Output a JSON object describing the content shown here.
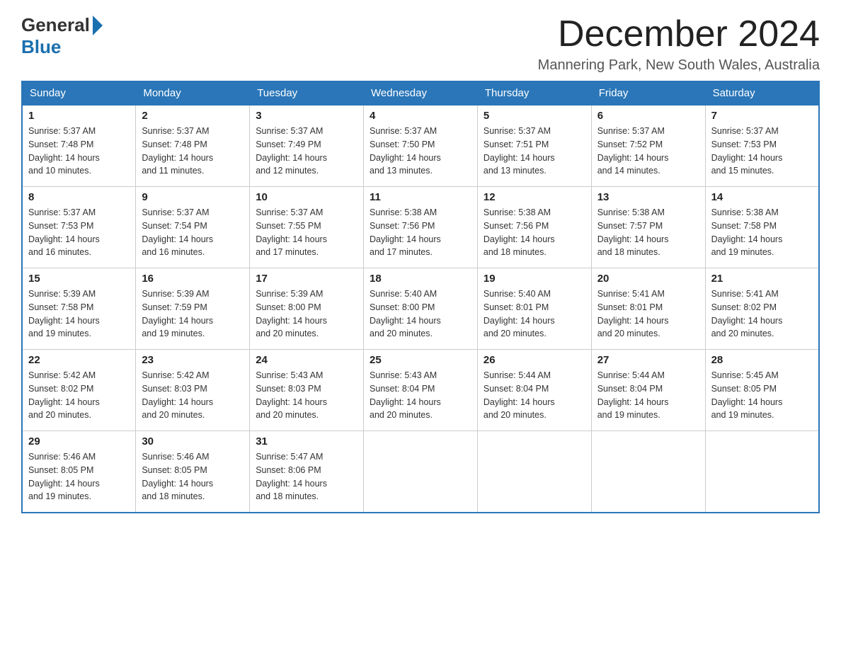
{
  "logo": {
    "general": "General",
    "blue": "Blue",
    "tagline": ""
  },
  "header": {
    "month": "December 2024",
    "location": "Mannering Park, New South Wales, Australia"
  },
  "weekdays": [
    "Sunday",
    "Monday",
    "Tuesday",
    "Wednesday",
    "Thursday",
    "Friday",
    "Saturday"
  ],
  "weeks": [
    [
      {
        "day": "1",
        "sunrise": "5:37 AM",
        "sunset": "7:48 PM",
        "daylight": "14 hours and 10 minutes."
      },
      {
        "day": "2",
        "sunrise": "5:37 AM",
        "sunset": "7:48 PM",
        "daylight": "14 hours and 11 minutes."
      },
      {
        "day": "3",
        "sunrise": "5:37 AM",
        "sunset": "7:49 PM",
        "daylight": "14 hours and 12 minutes."
      },
      {
        "day": "4",
        "sunrise": "5:37 AM",
        "sunset": "7:50 PM",
        "daylight": "14 hours and 13 minutes."
      },
      {
        "day": "5",
        "sunrise": "5:37 AM",
        "sunset": "7:51 PM",
        "daylight": "14 hours and 13 minutes."
      },
      {
        "day": "6",
        "sunrise": "5:37 AM",
        "sunset": "7:52 PM",
        "daylight": "14 hours and 14 minutes."
      },
      {
        "day": "7",
        "sunrise": "5:37 AM",
        "sunset": "7:53 PM",
        "daylight": "14 hours and 15 minutes."
      }
    ],
    [
      {
        "day": "8",
        "sunrise": "5:37 AM",
        "sunset": "7:53 PM",
        "daylight": "14 hours and 16 minutes."
      },
      {
        "day": "9",
        "sunrise": "5:37 AM",
        "sunset": "7:54 PM",
        "daylight": "14 hours and 16 minutes."
      },
      {
        "day": "10",
        "sunrise": "5:37 AM",
        "sunset": "7:55 PM",
        "daylight": "14 hours and 17 minutes."
      },
      {
        "day": "11",
        "sunrise": "5:38 AM",
        "sunset": "7:56 PM",
        "daylight": "14 hours and 17 minutes."
      },
      {
        "day": "12",
        "sunrise": "5:38 AM",
        "sunset": "7:56 PM",
        "daylight": "14 hours and 18 minutes."
      },
      {
        "day": "13",
        "sunrise": "5:38 AM",
        "sunset": "7:57 PM",
        "daylight": "14 hours and 18 minutes."
      },
      {
        "day": "14",
        "sunrise": "5:38 AM",
        "sunset": "7:58 PM",
        "daylight": "14 hours and 19 minutes."
      }
    ],
    [
      {
        "day": "15",
        "sunrise": "5:39 AM",
        "sunset": "7:58 PM",
        "daylight": "14 hours and 19 minutes."
      },
      {
        "day": "16",
        "sunrise": "5:39 AM",
        "sunset": "7:59 PM",
        "daylight": "14 hours and 19 minutes."
      },
      {
        "day": "17",
        "sunrise": "5:39 AM",
        "sunset": "8:00 PM",
        "daylight": "14 hours and 20 minutes."
      },
      {
        "day": "18",
        "sunrise": "5:40 AM",
        "sunset": "8:00 PM",
        "daylight": "14 hours and 20 minutes."
      },
      {
        "day": "19",
        "sunrise": "5:40 AM",
        "sunset": "8:01 PM",
        "daylight": "14 hours and 20 minutes."
      },
      {
        "day": "20",
        "sunrise": "5:41 AM",
        "sunset": "8:01 PM",
        "daylight": "14 hours and 20 minutes."
      },
      {
        "day": "21",
        "sunrise": "5:41 AM",
        "sunset": "8:02 PM",
        "daylight": "14 hours and 20 minutes."
      }
    ],
    [
      {
        "day": "22",
        "sunrise": "5:42 AM",
        "sunset": "8:02 PM",
        "daylight": "14 hours and 20 minutes."
      },
      {
        "day": "23",
        "sunrise": "5:42 AM",
        "sunset": "8:03 PM",
        "daylight": "14 hours and 20 minutes."
      },
      {
        "day": "24",
        "sunrise": "5:43 AM",
        "sunset": "8:03 PM",
        "daylight": "14 hours and 20 minutes."
      },
      {
        "day": "25",
        "sunrise": "5:43 AM",
        "sunset": "8:04 PM",
        "daylight": "14 hours and 20 minutes."
      },
      {
        "day": "26",
        "sunrise": "5:44 AM",
        "sunset": "8:04 PM",
        "daylight": "14 hours and 20 minutes."
      },
      {
        "day": "27",
        "sunrise": "5:44 AM",
        "sunset": "8:04 PM",
        "daylight": "14 hours and 19 minutes."
      },
      {
        "day": "28",
        "sunrise": "5:45 AM",
        "sunset": "8:05 PM",
        "daylight": "14 hours and 19 minutes."
      }
    ],
    [
      {
        "day": "29",
        "sunrise": "5:46 AM",
        "sunset": "8:05 PM",
        "daylight": "14 hours and 19 minutes."
      },
      {
        "day": "30",
        "sunrise": "5:46 AM",
        "sunset": "8:05 PM",
        "daylight": "14 hours and 18 minutes."
      },
      {
        "day": "31",
        "sunrise": "5:47 AM",
        "sunset": "8:06 PM",
        "daylight": "14 hours and 18 minutes."
      },
      null,
      null,
      null,
      null
    ]
  ],
  "labels": {
    "sunrise": "Sunrise:",
    "sunset": "Sunset:",
    "daylight": "Daylight:"
  },
  "colors": {
    "header_bg": "#2a76b8",
    "header_text": "#ffffff",
    "border": "#ccc",
    "accent": "#1a6faf"
  }
}
